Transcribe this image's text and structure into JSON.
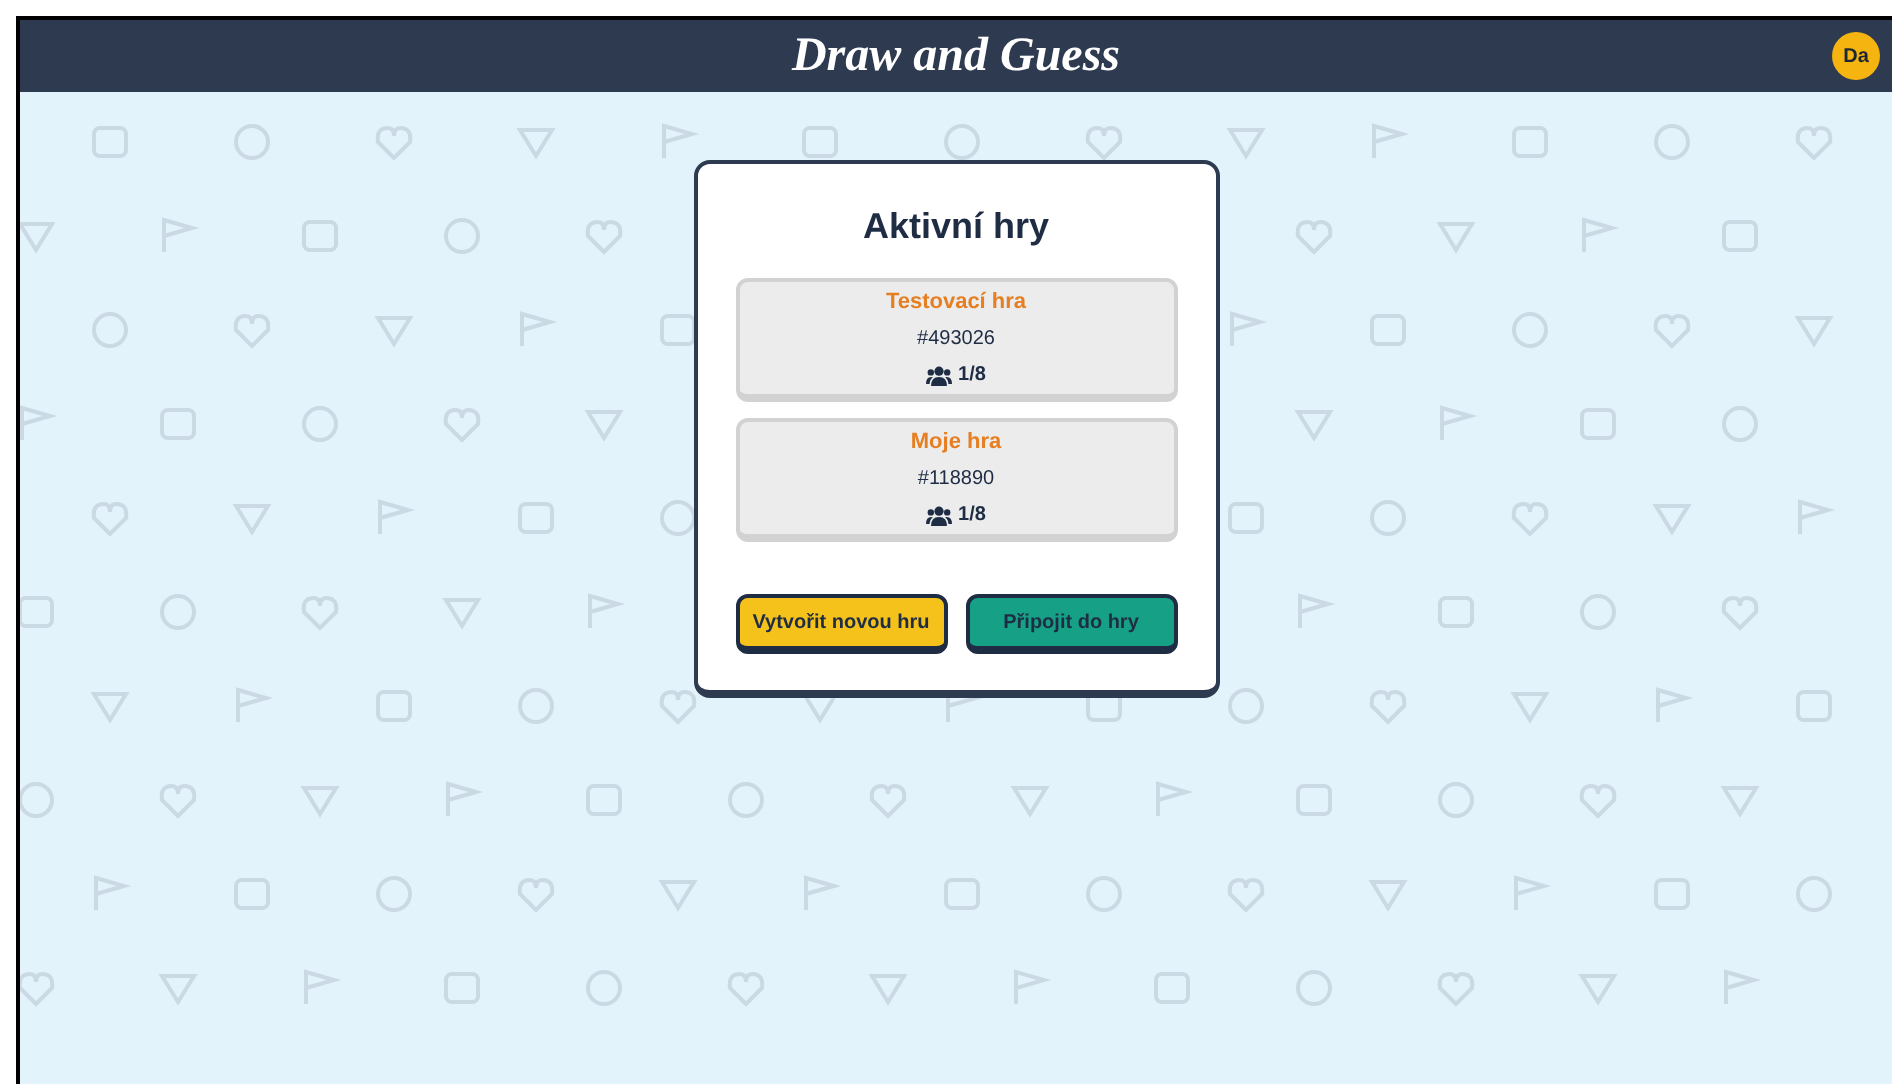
{
  "header": {
    "title": "Draw and Guess",
    "avatar": "Da"
  },
  "dialog": {
    "title": "Aktivní hry",
    "games": [
      {
        "name": "Testovací hra",
        "code": "#493026",
        "players": "1/8"
      },
      {
        "name": "Moje hra",
        "code": "#118890",
        "players": "1/8"
      }
    ],
    "buttons": [
      {
        "label": "Vytvořit novou hru",
        "kind": "create"
      },
      {
        "label": "Připojit do hry",
        "kind": "join"
      }
    ]
  }
}
